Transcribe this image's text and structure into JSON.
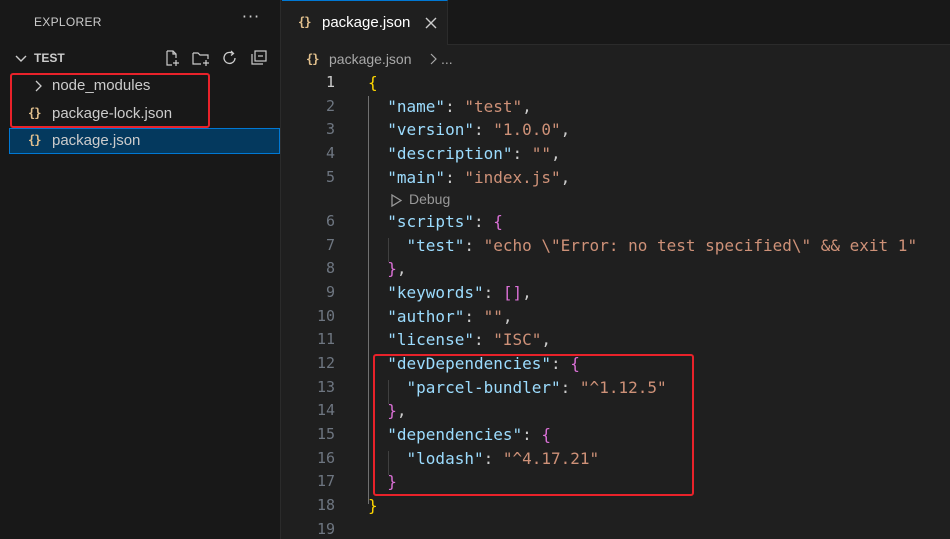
{
  "sidebar": {
    "title": "EXPLORER",
    "more_label": "···",
    "section_label": "TEST",
    "items": [
      {
        "label": "node_modules",
        "type": "folder"
      },
      {
        "label": "package-lock.json",
        "type": "json"
      },
      {
        "label": "package.json",
        "type": "json",
        "selected": true
      }
    ]
  },
  "tab": {
    "label": "package.json",
    "icon": "{}"
  },
  "breadcrumb": {
    "icon": "{}",
    "file": "package.json",
    "more": "..."
  },
  "codelens": {
    "label": "Debug"
  },
  "line_numbers": [
    "1",
    "2",
    "3",
    "4",
    "5",
    "6",
    "7",
    "8",
    "9",
    "10",
    "11",
    "12",
    "13",
    "14",
    "15",
    "16",
    "17",
    "18",
    "19"
  ],
  "code": {
    "l1": {
      "b": "{"
    },
    "l2": {
      "k": "\"name\"",
      "p": ": ",
      "s": "\"test\"",
      "e": ","
    },
    "l3": {
      "k": "\"version\"",
      "p": ": ",
      "s": "\"1.0.0\"",
      "e": ","
    },
    "l4": {
      "k": "\"description\"",
      "p": ": ",
      "s": "\"\"",
      "e": ","
    },
    "l5": {
      "k": "\"main\"",
      "p": ": ",
      "s": "\"index.js\"",
      "e": ","
    },
    "l6": {
      "k": "\"scripts\"",
      "p": ": ",
      "b": "{"
    },
    "l7": {
      "k": "\"test\"",
      "p": ": ",
      "s": "\"echo \\\"Error: no test specified\\\" && exit 1\""
    },
    "l8": {
      "b": "}",
      "e": ","
    },
    "l9": {
      "k": "\"keywords\"",
      "p": ": ",
      "b": "[]",
      "e": ","
    },
    "l10": {
      "k": "\"author\"",
      "p": ": ",
      "s": "\"\"",
      "e": ","
    },
    "l11": {
      "k": "\"license\"",
      "p": ": ",
      "s": "\"ISC\"",
      "e": ","
    },
    "l12": {
      "k": "\"devDependencies\"",
      "p": ": ",
      "b": "{"
    },
    "l13": {
      "k": "\"parcel-bundler\"",
      "p": ": ",
      "s": "\"^1.12.5\""
    },
    "l14": {
      "b": "}",
      "e": ","
    },
    "l15": {
      "k": "\"dependencies\"",
      "p": ": ",
      "b": "{"
    },
    "l16": {
      "k": "\"lodash\"",
      "p": ": ",
      "s": "\"^4.17.21\""
    },
    "l17": {
      "b": "}"
    },
    "l18": {
      "b": "}"
    }
  },
  "colors": {
    "key": "#9cdcfe",
    "string": "#ce9178",
    "bracket_level1": "#ffd700",
    "bracket_level2": "#da70d6",
    "highlight_box": "#e8222a",
    "selection_border": "#0078d4"
  }
}
